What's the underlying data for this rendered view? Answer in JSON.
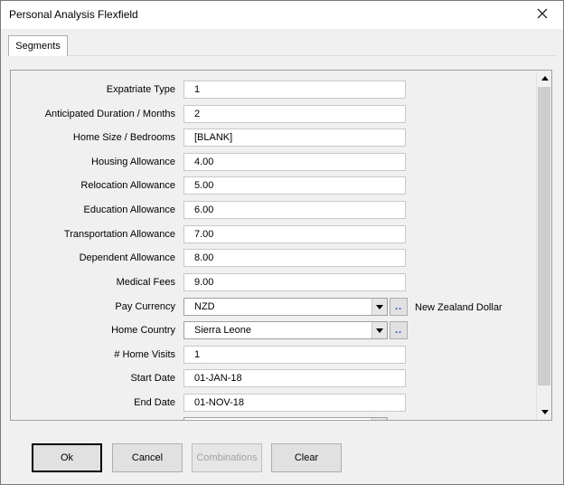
{
  "window": {
    "title": "Personal Analysis Flexfield"
  },
  "tabs": [
    {
      "label": "Segments"
    }
  ],
  "fields": [
    {
      "label": "Expatriate Type",
      "value": "1"
    },
    {
      "label": "Anticipated Duration / Months",
      "value": "2"
    },
    {
      "label": "Home Size / Bedrooms",
      "value": "[BLANK]"
    },
    {
      "label": "Housing Allowance",
      "value": "4.00"
    },
    {
      "label": "Relocation Allowance",
      "value": "5.00"
    },
    {
      "label": "Education Allowance",
      "value": "6.00"
    },
    {
      "label": "Transportation Allowance",
      "value": "7.00"
    },
    {
      "label": "Dependent Allowance",
      "value": "8.00"
    },
    {
      "label": "Medical Fees",
      "value": "9.00"
    }
  ],
  "pay_currency": {
    "label": "Pay Currency",
    "value": "NZD",
    "lov_label": "..",
    "description": "New Zealand Dollar"
  },
  "home_country": {
    "label": "Home Country",
    "value": "Sierra Leone",
    "lov_label": ".."
  },
  "home_visits": {
    "label": "# Home Visits",
    "value": "1"
  },
  "start_date": {
    "label": "Start Date",
    "value": "01-JAN-18"
  },
  "end_date": {
    "label": "End Date",
    "value": "01-NOV-18"
  },
  "buttons": {
    "ok": "Ok",
    "cancel": "Cancel",
    "combinations": "Combinations",
    "clear": "Clear"
  },
  "icons": {
    "close": "close-icon",
    "dropdown": "chevron-down-icon",
    "scroll_up": "scroll-up-icon",
    "scroll_down": "scroll-down-icon"
  }
}
